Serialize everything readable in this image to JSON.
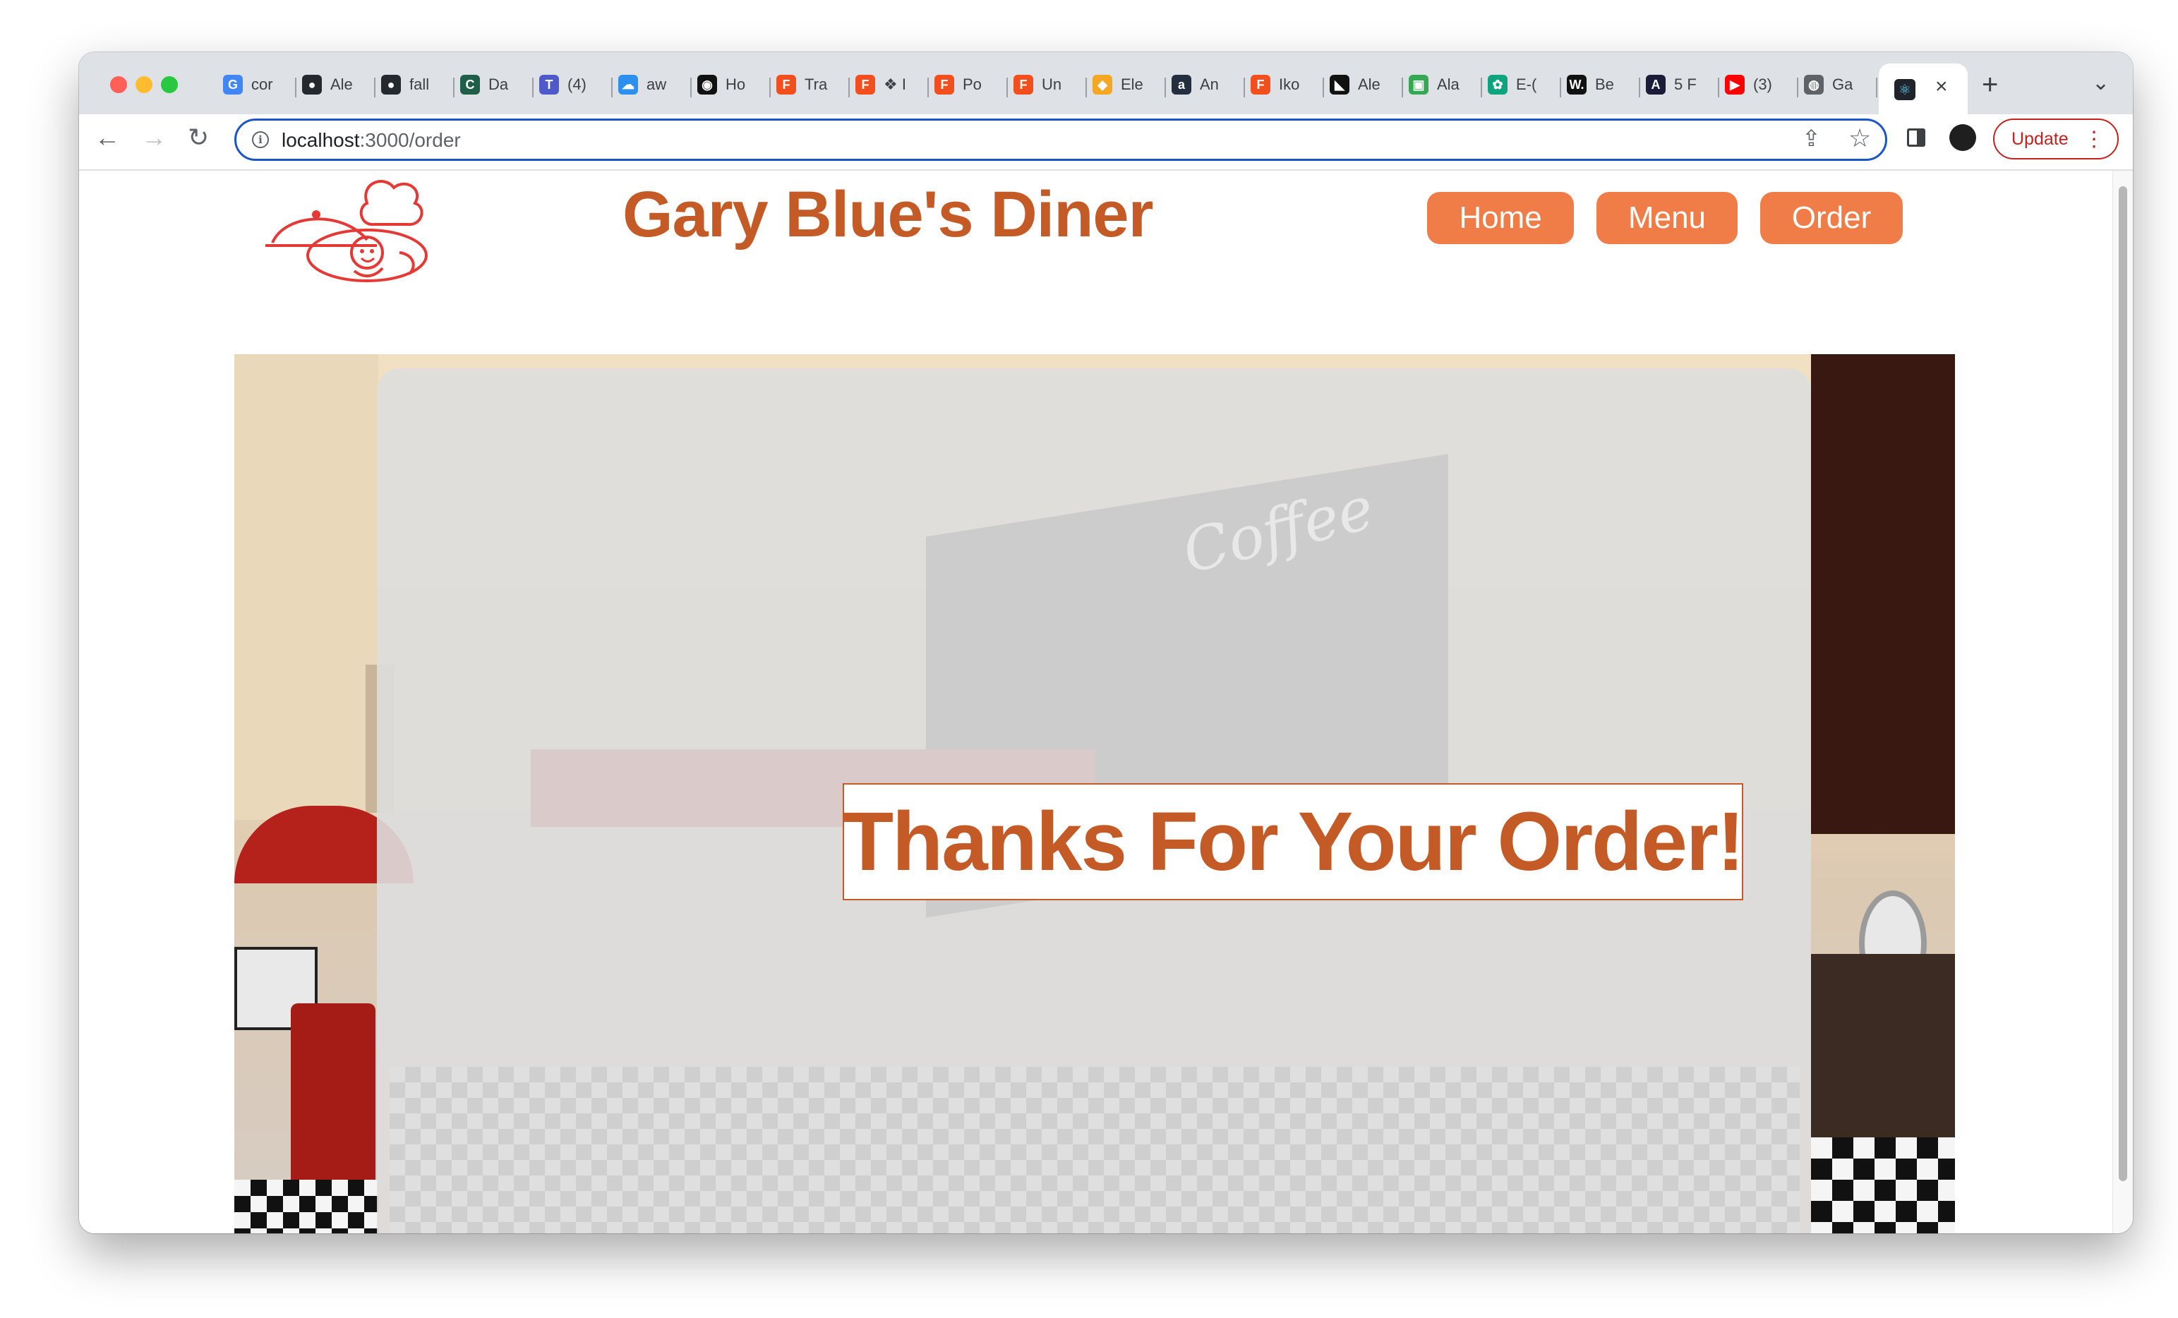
{
  "browser": {
    "tabs": [
      {
        "label": "cor",
        "icon": "google-icon",
        "color": "#4285f4",
        "glyph": "G"
      },
      {
        "label": "Ale",
        "icon": "github-icon",
        "color": "#24292e",
        "glyph": "●"
      },
      {
        "label": "fall",
        "icon": "github-icon",
        "color": "#24292e",
        "glyph": "●"
      },
      {
        "label": "Da",
        "icon": "codesandbox-icon",
        "color": "#1f5f4a",
        "glyph": "C"
      },
      {
        "label": "(4)",
        "icon": "teams-icon",
        "color": "#5059c9",
        "glyph": "T"
      },
      {
        "label": "aw",
        "icon": "cloud-icon",
        "color": "#2d8ff0",
        "glyph": "☁"
      },
      {
        "label": "Ho",
        "icon": "circle-icon",
        "color": "#111111",
        "glyph": "◉"
      },
      {
        "label": "Tra",
        "icon": "figma-icon",
        "color": "#f24e1e",
        "glyph": "F"
      },
      {
        "label": "❖ I",
        "icon": "figma-icon",
        "color": "#f24e1e",
        "glyph": "F"
      },
      {
        "label": "Po",
        "icon": "figma-icon",
        "color": "#f24e1e",
        "glyph": "F"
      },
      {
        "label": "Un",
        "icon": "figma-icon",
        "color": "#f24e1e",
        "glyph": "F"
      },
      {
        "label": "Ele",
        "icon": "shopping-bag-icon",
        "color": "#f5a623",
        "glyph": "◆"
      },
      {
        "label": "An",
        "icon": "amazon-icon",
        "color": "#232f3e",
        "glyph": "a"
      },
      {
        "label": "Iko",
        "icon": "figma-icon",
        "color": "#f24e1e",
        "glyph": "F"
      },
      {
        "label": "Ale",
        "icon": "framer-icon",
        "color": "#111111",
        "glyph": "◣"
      },
      {
        "label": "Ala",
        "icon": "blocks-icon",
        "color": "#34a853",
        "glyph": "▣"
      },
      {
        "label": "E-(",
        "icon": "chatgpt-icon",
        "color": "#10a37f",
        "glyph": "✿"
      },
      {
        "label": "Be",
        "icon": "w-icon",
        "color": "#111111",
        "glyph": "W."
      },
      {
        "label": "5 F",
        "icon": "a-icon",
        "color": "#1b1b3a",
        "glyph": "A"
      },
      {
        "label": "(3)",
        "icon": "youtube-icon",
        "color": "#ff0000",
        "glyph": "▶"
      },
      {
        "label": "Ga",
        "icon": "globe-icon",
        "color": "#5f6368",
        "glyph": "◍"
      }
    ],
    "active_tab_icon": "react-icon",
    "url_host": "localhost",
    "url_path": ":3000/order",
    "update_label": "Update"
  },
  "site": {
    "title": "Gary Blue's Diner",
    "nav": [
      {
        "label": "Home"
      },
      {
        "label": "Menu"
      },
      {
        "label": "Order"
      }
    ],
    "background_sign": "Coffee",
    "message": "Thanks For Your Order!",
    "colors": {
      "brand_text": "#c45a26",
      "nav_button": "#f07c48",
      "logo_red": "#e53935"
    }
  }
}
